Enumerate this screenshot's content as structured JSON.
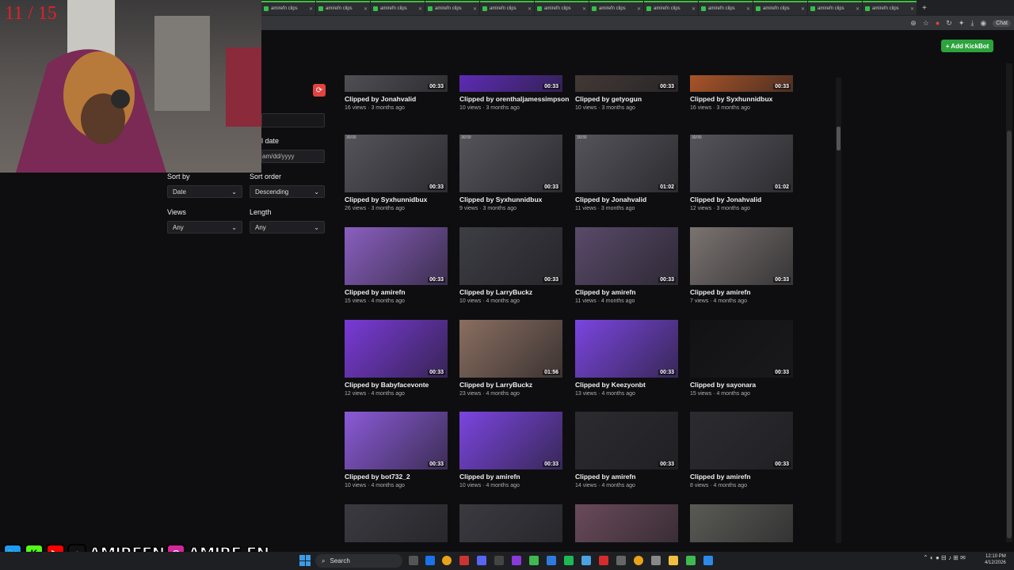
{
  "overlay": {
    "counter": "11 / 15",
    "socials": {
      "handle_1": "AMIREFN",
      "handle_2": "AMIRE.FN",
      "kick_letter": "K"
    }
  },
  "browser": {
    "tab_label": "amirefn clips",
    "tab_count": 12,
    "chat_label": "Chat"
  },
  "header": {
    "add_kickbot": "+ Add KickBot"
  },
  "filters": {
    "date_label": "l date",
    "date_placeholder": "am/dd/yyyy",
    "sort_by_label": "Sort by",
    "sort_by_value": "Date",
    "sort_order_label": "Sort order",
    "sort_order_value": "Descending",
    "views_label": "Views",
    "views_value": "Any",
    "length_label": "Length",
    "length_value": "Any"
  },
  "clips": [
    {
      "title": "Clipped by Jonahvalid",
      "meta": "16 views · 3 months ago",
      "duration": "00:33",
      "color": "#5a5a60"
    },
    {
      "title": "Clipped by orenthaljamessimpson",
      "meta": "10 views · 3 months ago",
      "duration": "00:33",
      "color": "#6b2fd6"
    },
    {
      "title": "Clipped by getyogun",
      "meta": "10 views · 3 months ago",
      "duration": "00:33",
      "color": "#4a3f3a"
    },
    {
      "title": "Clipped by Syxhunnidbux",
      "meta": "16 views · 3 months ago",
      "duration": "00:33",
      "color": "#c8602a"
    },
    {
      "title": "Clipped by Syxhunnidbux",
      "meta": "26 views · 3 months ago",
      "duration": "00:33",
      "color": "#55545a",
      "badge": "30/30"
    },
    {
      "title": "Clipped by Syxhunnidbux",
      "meta": "9 views · 3 months ago",
      "duration": "00:33",
      "color": "#55545a",
      "badge": "30/30"
    },
    {
      "title": "Clipped by Jonahvalid",
      "meta": "11 views · 3 months ago",
      "duration": "01:02",
      "color": "#55545a",
      "badge": "30/30"
    },
    {
      "title": "Clipped by Jonahvalid",
      "meta": "12 views · 3 months ago",
      "duration": "01:02",
      "color": "#55545a",
      "badge": "30/30"
    },
    {
      "title": "Clipped by amirefn",
      "meta": "15 views · 4 months ago",
      "duration": "00:33",
      "color": "#8a5fc0"
    },
    {
      "title": "Clipped by LarryBuckz",
      "meta": "10 views · 4 months ago",
      "duration": "00:33",
      "color": "#3d3d44"
    },
    {
      "title": "Clipped by amirefn",
      "meta": "11 views · 4 months ago",
      "duration": "00:33",
      "color": "#5a4a6a"
    },
    {
      "title": "Clipped by amirefn",
      "meta": "7 views · 4 months ago",
      "duration": "00:33",
      "color": "#7a7370"
    },
    {
      "title": "Clipped by Babyfacevonte",
      "meta": "12 views · 4 months ago",
      "duration": "00:33",
      "color": "#7a3ad8"
    },
    {
      "title": "Clipped by LarryBuckz",
      "meta": "23 views · 4 months ago",
      "duration": "01:56",
      "color": "#8a6e60"
    },
    {
      "title": "Clipped by Keezyonbt",
      "meta": "13 views · 4 months ago",
      "duration": "00:33",
      "color": "#7b45e0"
    },
    {
      "title": "Clipped by sayonara",
      "meta": "15 views · 4 months ago",
      "duration": "00:33",
      "color": "#121214"
    },
    {
      "title": "Clipped by bot732_2",
      "meta": "10 views · 4 months ago",
      "duration": "00:33",
      "color": "#8b5ad8"
    },
    {
      "title": "Clipped by amirefn",
      "meta": "10 views · 4 months ago",
      "duration": "00:33",
      "color": "#7b45e0"
    },
    {
      "title": "Clipped by amirefn",
      "meta": "14 views · 4 months ago",
      "duration": "00:33",
      "color": "#2b2b30"
    },
    {
      "title": "Clipped by amirefn",
      "meta": "8 views · 4 months ago",
      "duration": "00:33",
      "color": "#2b2b30"
    },
    {
      "title": "",
      "meta": "",
      "duration": "",
      "color": "#3a3a40"
    },
    {
      "title": "",
      "meta": "",
      "duration": "",
      "color": "#3a3a40"
    },
    {
      "title": "",
      "meta": "",
      "duration": "",
      "color": "#6a4a5a"
    },
    {
      "title": "",
      "meta": "",
      "duration": "",
      "color": "#5a5a55"
    }
  ],
  "taskbar": {
    "search_placeholder": "Search",
    "time": "12:10 PM",
    "date": "4/12/2026"
  },
  "colors": {
    "accent_green": "#2ca33c",
    "refresh_red": "#e34242",
    "counter_red": "#e0202a"
  }
}
